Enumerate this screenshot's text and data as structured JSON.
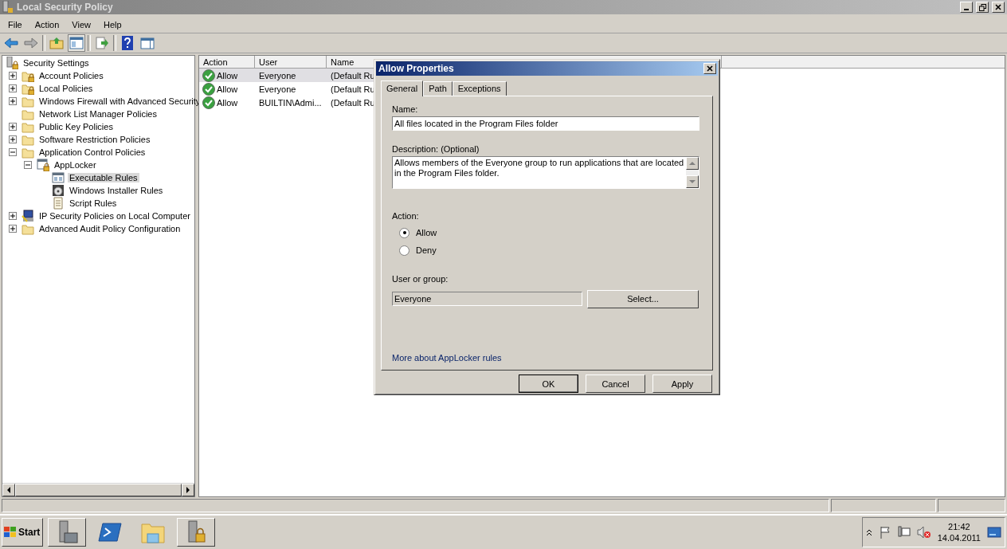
{
  "window": {
    "title": "Local Security Policy"
  },
  "menu": [
    "File",
    "Action",
    "View",
    "Help"
  ],
  "toolbar": [
    [
      {
        "kind": "back",
        "pressed": false
      },
      {
        "kind": "forward",
        "pressed": false
      }
    ],
    [
      {
        "kind": "up",
        "pressed": false
      },
      {
        "kind": "tree",
        "pressed": true
      }
    ],
    [
      {
        "kind": "export",
        "pressed": false
      }
    ],
    [
      {
        "kind": "help",
        "pressed": false
      },
      {
        "kind": "pane",
        "pressed": false
      }
    ]
  ],
  "tree": {
    "label": "Security Settings",
    "children": [
      {
        "label": "Account Policies",
        "kind": "lockfolder",
        "expandable": true,
        "expanded": false,
        "selected": false
      },
      {
        "label": "Local Policies",
        "kind": "lockfolder",
        "expandable": true,
        "expanded": false,
        "selected": false
      },
      {
        "label": "Windows Firewall with Advanced Security",
        "kind": "folder",
        "expandable": true,
        "expanded": false,
        "selected": false
      },
      {
        "label": "Network List Manager Policies",
        "kind": "folder",
        "expandable": false,
        "selected": false
      },
      {
        "label": "Public Key Policies",
        "kind": "folder",
        "expandable": true,
        "expanded": false,
        "selected": false
      },
      {
        "label": "Software Restriction Policies",
        "kind": "folder",
        "expandable": true,
        "expanded": false,
        "selected": false
      },
      {
        "label": "Application Control Policies",
        "kind": "folder",
        "expandable": true,
        "expanded": true,
        "selected": false,
        "children": [
          {
            "label": "AppLocker",
            "kind": "applocker",
            "expandable": true,
            "expanded": true,
            "selected": false,
            "children": [
              {
                "label": "Executable Rules",
                "kind": "rules",
                "expandable": false,
                "selected": true
              },
              {
                "label": "Windows Installer Rules",
                "kind": "installer",
                "expandable": false,
                "selected": false
              },
              {
                "label": "Script Rules",
                "kind": "script",
                "expandable": false,
                "selected": false
              }
            ]
          }
        ]
      },
      {
        "label": "IP Security Policies on Local Computer",
        "kind": "ipsec",
        "expandable": true,
        "expanded": false,
        "selected": false
      },
      {
        "label": "Advanced Audit Policy Configuration",
        "kind": "folder",
        "expandable": true,
        "expanded": false,
        "selected": false
      }
    ]
  },
  "list": {
    "columns": [
      "Action",
      "User",
      "Name"
    ],
    "rows": [
      {
        "cells": [
          "Allow",
          "Everyone",
          "(Default Ru"
        ],
        "selected": true
      },
      {
        "cells": [
          "Allow",
          "Everyone",
          "(Default Ru"
        ],
        "selected": false
      },
      {
        "cells": [
          "Allow",
          "BUILTIN\\Admi...",
          "(Default Ru"
        ],
        "selected": false
      }
    ]
  },
  "dialog": {
    "title": "Allow Properties",
    "tabs": [
      {
        "label": "General",
        "selected": true
      },
      {
        "label": "Path",
        "selected": false
      },
      {
        "label": "Exceptions",
        "selected": false
      }
    ],
    "name_label": "Name:",
    "name_value": "All files located in the Program Files folder",
    "description_label": "Description: (Optional)",
    "description_value": "Allows members of the Everyone group to run applications that are located in the Program Files folder.",
    "action_label": "Action:",
    "radios": [
      {
        "label": "Allow",
        "selected": true
      },
      {
        "label": "Deny",
        "selected": false
      }
    ],
    "user_label": "User or group:",
    "user_value": "Everyone",
    "select_button": "Select...",
    "link": "More about AppLocker rules",
    "buttons": [
      {
        "label": "OK",
        "default": true
      },
      {
        "label": "Cancel",
        "default": false
      },
      {
        "label": "Apply",
        "default": false
      }
    ]
  },
  "taskbar": {
    "start": "Start",
    "apps": [
      {
        "kind": "server",
        "raised": true
      },
      {
        "kind": "powershell",
        "raised": false
      },
      {
        "kind": "explorer",
        "raised": false
      },
      {
        "kind": "secpol",
        "raised": true
      }
    ],
    "time": "21:42",
    "date": "14.04.2011"
  }
}
